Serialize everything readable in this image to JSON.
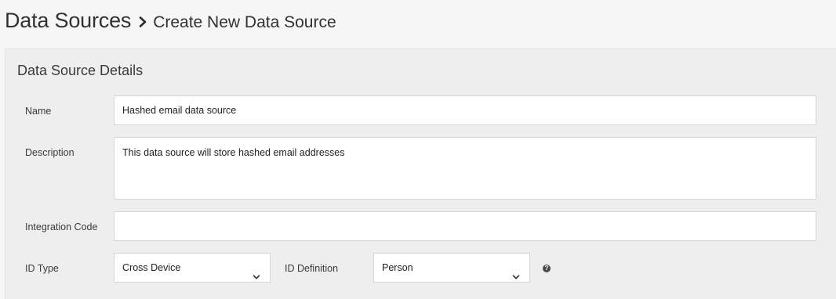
{
  "breadcrumb": {
    "root": "Data Sources",
    "current": "Create New Data Source",
    "separator_icon": "chevron-right-icon"
  },
  "panel": {
    "title": "Data Source Details"
  },
  "form": {
    "name": {
      "label": "Name",
      "value": "Hashed email data source"
    },
    "description": {
      "label": "Description",
      "value": "This data source will store hashed email addresses"
    },
    "integration_code": {
      "label": "Integration Code",
      "value": ""
    },
    "id_type": {
      "label": "ID Type",
      "selected": "Cross Device"
    },
    "id_definition": {
      "label": "ID Definition",
      "selected": "Person",
      "help_icon": "?"
    }
  },
  "colors": {
    "background": "#f6f6f6",
    "panel": "#eeeeee",
    "field_border": "#d5d5d5"
  }
}
